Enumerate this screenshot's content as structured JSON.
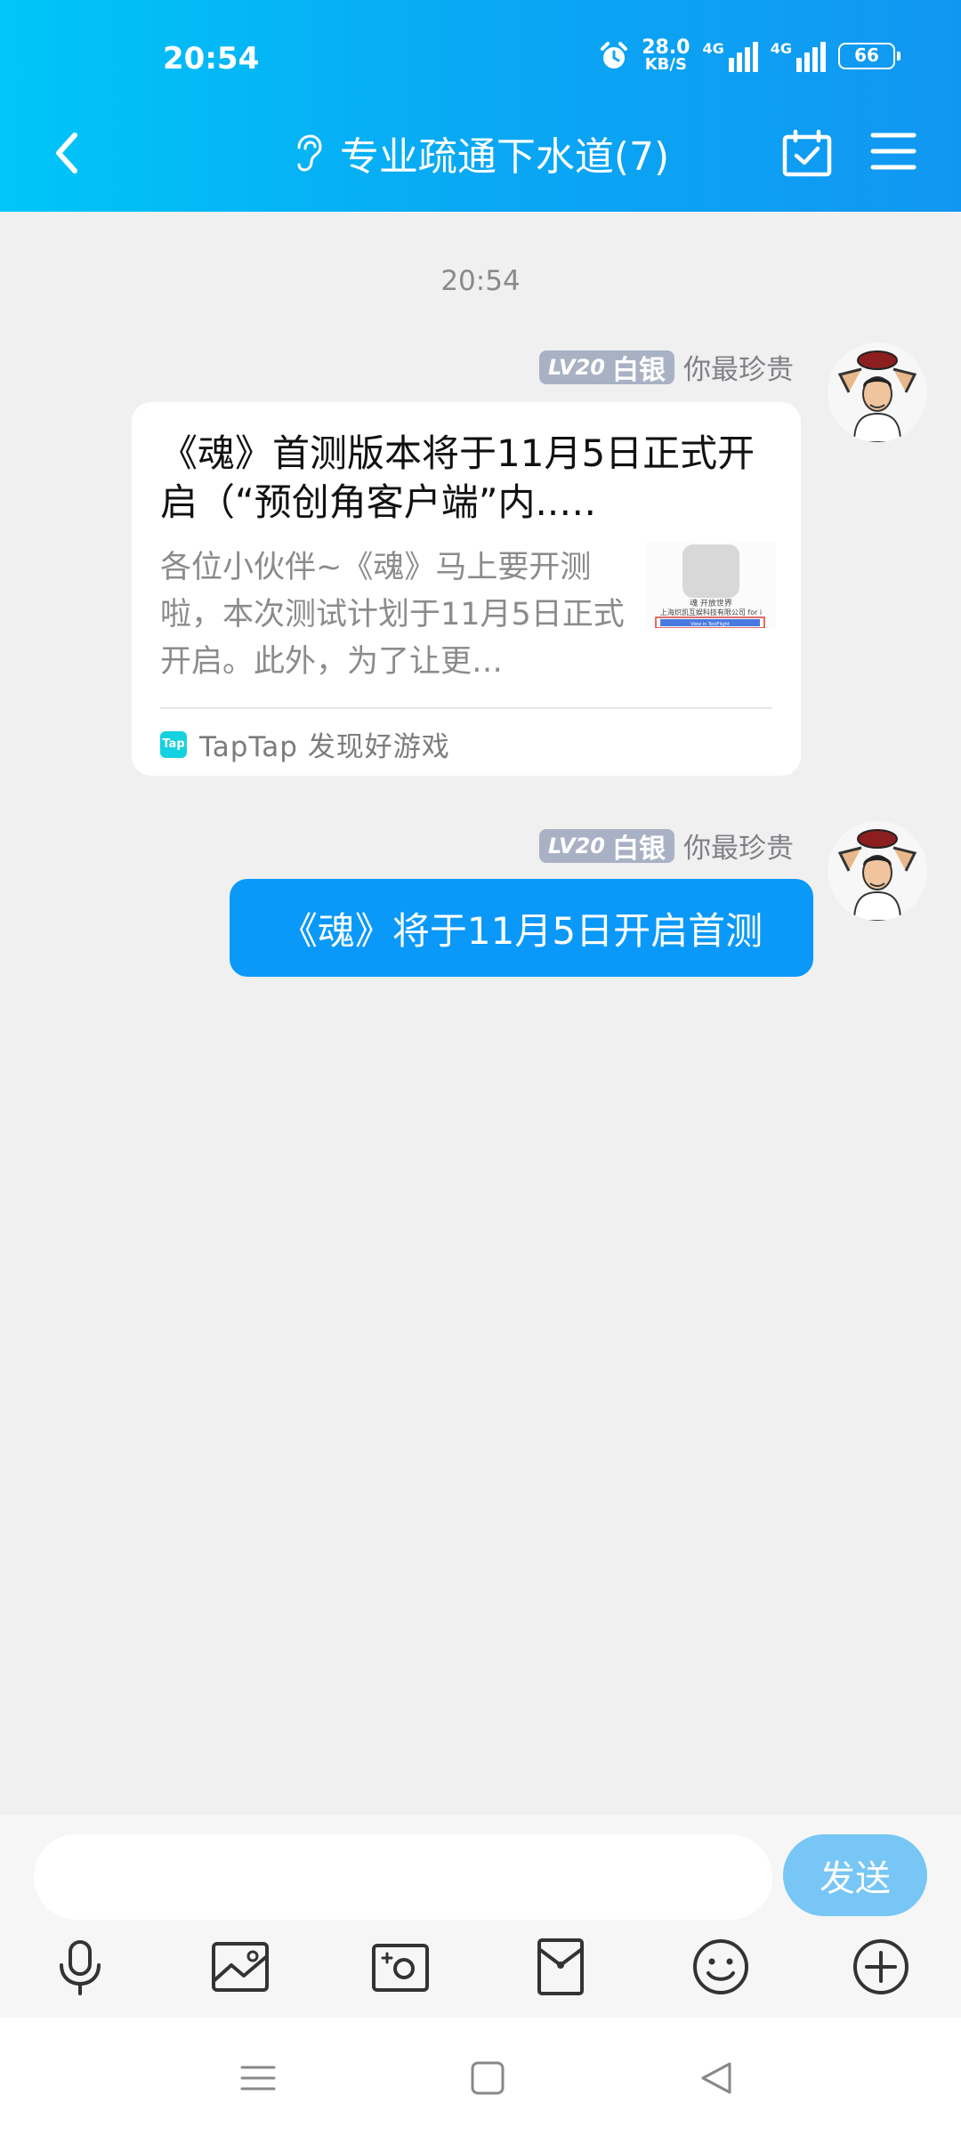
{
  "status_bar": {
    "time": "20:54",
    "speed_value": "28.0",
    "speed_unit": "KB/S",
    "net1": "4G",
    "net2": "4G",
    "battery": "66"
  },
  "header": {
    "title": "专业疏通下水道(7)"
  },
  "chat": {
    "timestamp": "20:54",
    "messages": [
      {
        "sender_level": "LV20",
        "sender_rank": "白银",
        "sender_name": "你最珍贵",
        "card": {
          "title": "《魂》首测版本将于11月5日正式开启（“预创角客户端”内..…",
          "description": "各位小伙伴~《魂》马上要开测啦，本次测试计划于11月5日正式开启。此外，为了让更…",
          "source": "TapTap 发现好游戏",
          "logo_text": "Tap",
          "thumb_line1": "魂 开放世界",
          "thumb_line2": "上海炽凯互娱科技有限公司 for i",
          "thumb_button": "View in TestFlight"
        }
      },
      {
        "sender_level": "LV20",
        "sender_rank": "白银",
        "sender_name": "你最珍贵",
        "text": "《魂》将于11月5日开启首测"
      }
    ]
  },
  "input": {
    "value": "",
    "placeholder": "",
    "send_label": "发送"
  },
  "colors": {
    "header_start": "#00c6f8",
    "header_end": "#1197f2",
    "bubble": "#0a99f9",
    "send": "#77c6f5"
  }
}
